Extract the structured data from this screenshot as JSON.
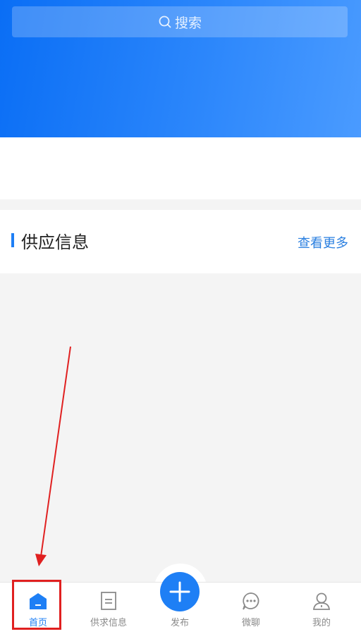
{
  "search": {
    "placeholder": "搜索",
    "icon": "search-icon"
  },
  "section": {
    "title": "供应信息",
    "more_link": "查看更多"
  },
  "tabbar": {
    "tabs": [
      {
        "label": "首页",
        "icon": "home-icon",
        "active": true
      },
      {
        "label": "供求信息",
        "icon": "document-icon",
        "active": false
      },
      {
        "label": "发布",
        "icon": "plus-icon",
        "active": false
      },
      {
        "label": "微聊",
        "icon": "chat-icon",
        "active": false
      },
      {
        "label": "我的",
        "icon": "user-icon",
        "active": false
      }
    ]
  },
  "colors": {
    "brand": "#1e7ff5",
    "header_start": "#0a6ef5",
    "header_end": "#4a9bff",
    "annotation": "#e02020",
    "inactive_text": "#8a8a8a"
  }
}
